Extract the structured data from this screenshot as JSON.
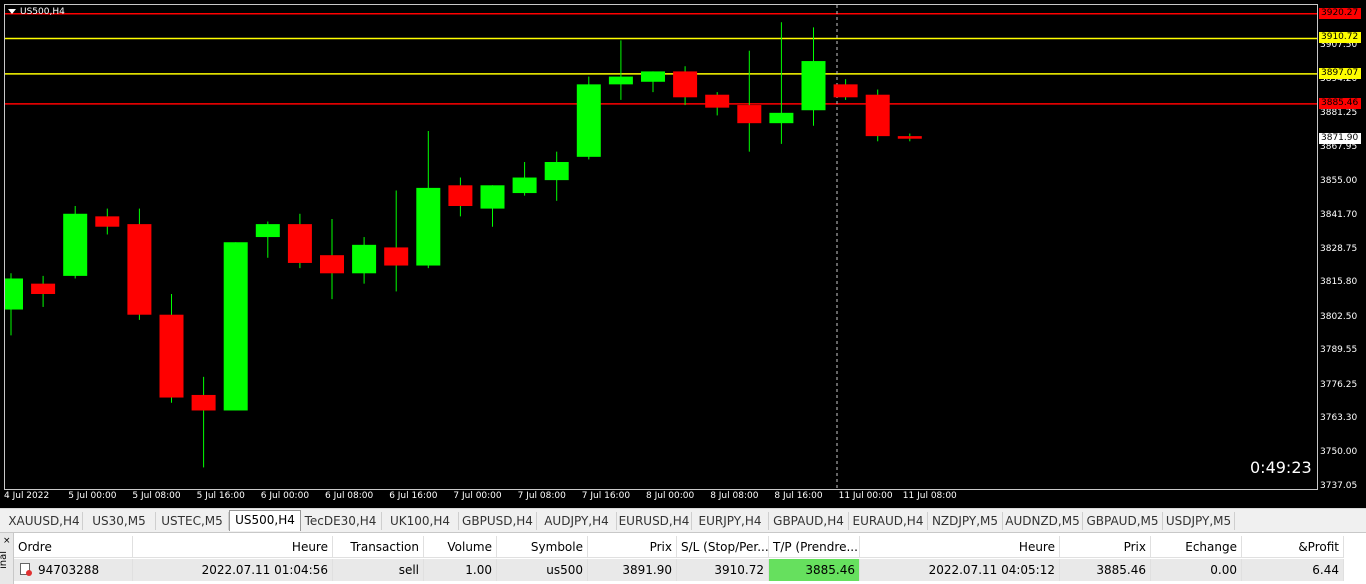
{
  "chart": {
    "symbol_title": "US500,H4",
    "countdown": "0:49:23",
    "price_min": 3737.05,
    "price_max": 3922.5,
    "price_ticks": [
      "3907.50",
      "3894.20",
      "3881.25",
      "3867.95",
      "3855.00",
      "3841.70",
      "3828.75",
      "3815.80",
      "3802.50",
      "3789.55",
      "3776.25",
      "3763.30",
      "3750.00",
      "3737.05"
    ],
    "time_ticks": [
      "4 Jul 2022",
      "5 Jul 00:00",
      "5 Jul 08:00",
      "5 Jul 16:00",
      "6 Jul 00:00",
      "6 Jul 08:00",
      "6 Jul 16:00",
      "7 Jul 00:00",
      "7 Jul 08:00",
      "7 Jul 16:00",
      "8 Jul 00:00",
      "8 Jul 08:00",
      "8 Jul 16:00",
      "11 Jul 00:00",
      "11 Jul 08:00"
    ],
    "levels": [
      {
        "price": 3920.27,
        "label": "3920.27",
        "color": "#ff0000",
        "tag_bg": "#ff0000",
        "tag_fg": "#000000"
      },
      {
        "price": 3910.72,
        "label": "3910.72",
        "color": "#ffff00",
        "tag_bg": "#ffff00",
        "tag_fg": "#000000"
      },
      {
        "price": 3897.07,
        "label": "3897.07",
        "color": "#ffff00",
        "tag_bg": "#ffff00",
        "tag_fg": "#000000"
      },
      {
        "price": 3885.46,
        "label": "3885.46",
        "color": "#ff0000",
        "tag_bg": "#ff0000",
        "tag_fg": "#000000"
      }
    ],
    "current_price": {
      "price": 3871.9,
      "label": "3871.90"
    },
    "colors": {
      "bull": "#00ff00",
      "bear": "#ff0000",
      "background": "#000000",
      "wick": "#00ff00"
    }
  },
  "chart_data": {
    "type": "candlestick",
    "title": "US500,H4",
    "ylim": [
      3737.05,
      3922.5
    ],
    "grid": false,
    "candles": [
      {
        "o": 3806,
        "h": 3820,
        "l": 3796,
        "c": 3818
      },
      {
        "o": 3816,
        "h": 3819,
        "l": 3807,
        "c": 3812
      },
      {
        "o": 3819,
        "h": 3846,
        "l": 3818,
        "c": 3843
      },
      {
        "o": 3842,
        "h": 3845,
        "l": 3835,
        "c": 3838
      },
      {
        "o": 3839,
        "h": 3845,
        "l": 3802,
        "c": 3804
      },
      {
        "o": 3804,
        "h": 3812,
        "l": 3770,
        "c": 3772
      },
      {
        "o": 3773,
        "h": 3780,
        "l": 3745,
        "c": 3767
      },
      {
        "o": 3767,
        "h": 3832,
        "l": 3767,
        "c": 3832
      },
      {
        "o": 3834,
        "h": 3840,
        "l": 3826,
        "c": 3839
      },
      {
        "o": 3839,
        "h": 3843,
        "l": 3822,
        "c": 3824
      },
      {
        "o": 3827,
        "h": 3841,
        "l": 3810,
        "c": 3820
      },
      {
        "o": 3820,
        "h": 3834,
        "l": 3816,
        "c": 3831
      },
      {
        "o": 3830,
        "h": 3852,
        "l": 3813,
        "c": 3823
      },
      {
        "o": 3823,
        "h": 3875,
        "l": 3822,
        "c": 3853
      },
      {
        "o": 3854,
        "h": 3857,
        "l": 3842,
        "c": 3846
      },
      {
        "o": 3845,
        "h": 3854,
        "l": 3838,
        "c": 3854
      },
      {
        "o": 3851,
        "h": 3863,
        "l": 3850,
        "c": 3857
      },
      {
        "o": 3856,
        "h": 3867,
        "l": 3848,
        "c": 3863
      },
      {
        "o": 3865,
        "h": 3896,
        "l": 3864,
        "c": 3893
      },
      {
        "o": 3893,
        "h": 3910,
        "l": 3887,
        "c": 3896
      },
      {
        "o": 3894,
        "h": 3898,
        "l": 3890,
        "c": 3898
      },
      {
        "o": 3898,
        "h": 3900,
        "l": 3885,
        "c": 3888
      },
      {
        "o": 3889,
        "h": 3890,
        "l": 3881,
        "c": 3884
      },
      {
        "o": 3885,
        "h": 3906,
        "l": 3867,
        "c": 3878
      },
      {
        "o": 3878,
        "h": 3917,
        "l": 3870,
        "c": 3882
      },
      {
        "o": 3883,
        "h": 3915,
        "l": 3877,
        "c": 3902
      },
      {
        "o": 3893,
        "h": 3895,
        "l": 3887,
        "c": 3888
      },
      {
        "o": 3889,
        "h": 3891,
        "l": 3871,
        "c": 3873
      },
      {
        "o": 3873,
        "h": 3874,
        "l": 3871,
        "c": 3872
      }
    ]
  },
  "tabs": [
    "XAUUSD,H4",
    "US30,M5",
    "USTEC,M5",
    "US500,H4",
    "TecDE30,H4",
    "UK100,H4",
    "GBPUSD,H4",
    "AUDJPY,H4",
    "EURUSD,H4",
    "EURJPY,H4",
    "GBPAUD,H4",
    "EURAUD,H4",
    "NZDJPY,M5",
    "AUDNZD,M5",
    "GBPAUD,M5",
    "USDJPY,M5"
  ],
  "active_tab": 3,
  "terminal": {
    "side_label": "inal",
    "close_glyph": "×",
    "headers": [
      "Ordre",
      "Heure",
      "Transaction",
      "Volume",
      "Symbole",
      "Prix",
      "S/L (Stop/Per...",
      "T/P (Prendre...",
      "Heure",
      "Prix",
      "Echange",
      "&Profit"
    ],
    "row": [
      "94703288",
      "2022.07.11 01:04:56",
      "sell",
      "1.00",
      "us500",
      "3891.90",
      "3910.72",
      "3885.46",
      "2022.07.11 04:05:12",
      "3885.46",
      "0.00",
      "6.44"
    ],
    "highlight_color": "#66e05e"
  }
}
